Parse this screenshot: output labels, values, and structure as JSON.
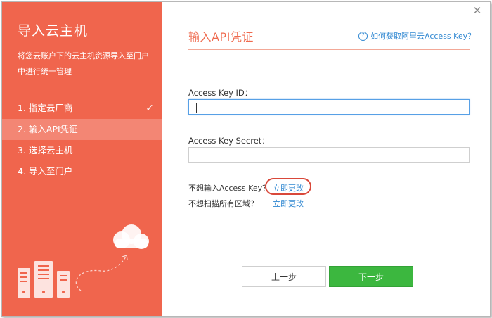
{
  "sidebar": {
    "title": "导入云主机",
    "description": "将您云账户下的云主机资源导入至门户中进行统一管理",
    "steps": [
      {
        "label": "1. 指定云厂商",
        "done": true
      },
      {
        "label": "2. 输入API凭证",
        "active": true
      },
      {
        "label": "3. 选择云主机"
      },
      {
        "label": "4. 导入至门户"
      }
    ],
    "check_icon": "✓"
  },
  "main": {
    "title": "输入API凭证",
    "help_link": "如何获取阿里云Access Key？",
    "access_key_id_label": "Access Key ID：",
    "access_key_id_value": "",
    "access_key_secret_label": "Access Key Secret：",
    "access_key_secret_value": "",
    "no_key_text": "不想输入Access Key？",
    "no_key_link": "立即更改",
    "no_scan_text": "不想扫描所有区域？",
    "no_scan_link": "立即更改",
    "prev_button": "上一步",
    "next_button": "下一步",
    "close_icon": "✕"
  },
  "colors": {
    "sidebar_bg": "#f0654d",
    "accent": "#ef6a4e",
    "link": "#2f87d1",
    "primary_button": "#3cb73f",
    "highlight_ring": "#d9483a"
  }
}
